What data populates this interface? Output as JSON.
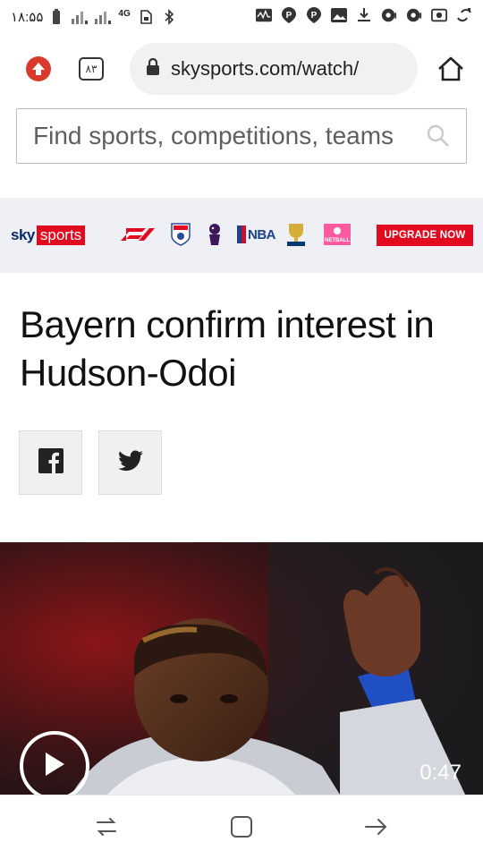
{
  "status_bar": {
    "time": "۱۸:۵۵",
    "network": "4G",
    "icons_left": [
      "battery-icon",
      "signal-icon",
      "signal-icon",
      "sim-icon",
      "bluetooth-icon"
    ],
    "icons_right": [
      "activity-icon",
      "parking-icon",
      "parking-icon",
      "image-icon",
      "download-icon",
      "chat-icon",
      "chat-icon",
      "cast-icon",
      "sync-icon"
    ]
  },
  "browser": {
    "tab_count": "۸۳",
    "url": "skysports.com/watch/",
    "home_icon": "home-icon",
    "update_icon": "arrow-up-icon",
    "lock_icon": "lock-icon"
  },
  "search": {
    "placeholder": "Find sports, competitions, teams"
  },
  "brand_band": {
    "logo_sky": "sky",
    "logo_sports": "sports",
    "partners": [
      "F1",
      "EFL",
      "Premier League",
      "NBA",
      "Ryder Cup",
      "Vitality Netball"
    ],
    "partner_labels": {
      "nba": "NBA",
      "netball": "NETBALL"
    },
    "upgrade_label": "UPGRADE NOW",
    "accent": "#e10a1e"
  },
  "article": {
    "headline": "Bayern confirm interest in Hudson-Odoi"
  },
  "share": {
    "facebook_icon": "facebook-icon",
    "twitter_icon": "twitter-icon"
  },
  "video": {
    "duration": "0:47",
    "play_icon": "play-icon"
  },
  "nav": {
    "buttons": [
      "recent-apps-icon",
      "home-square-icon",
      "back-arrow-icon"
    ]
  }
}
